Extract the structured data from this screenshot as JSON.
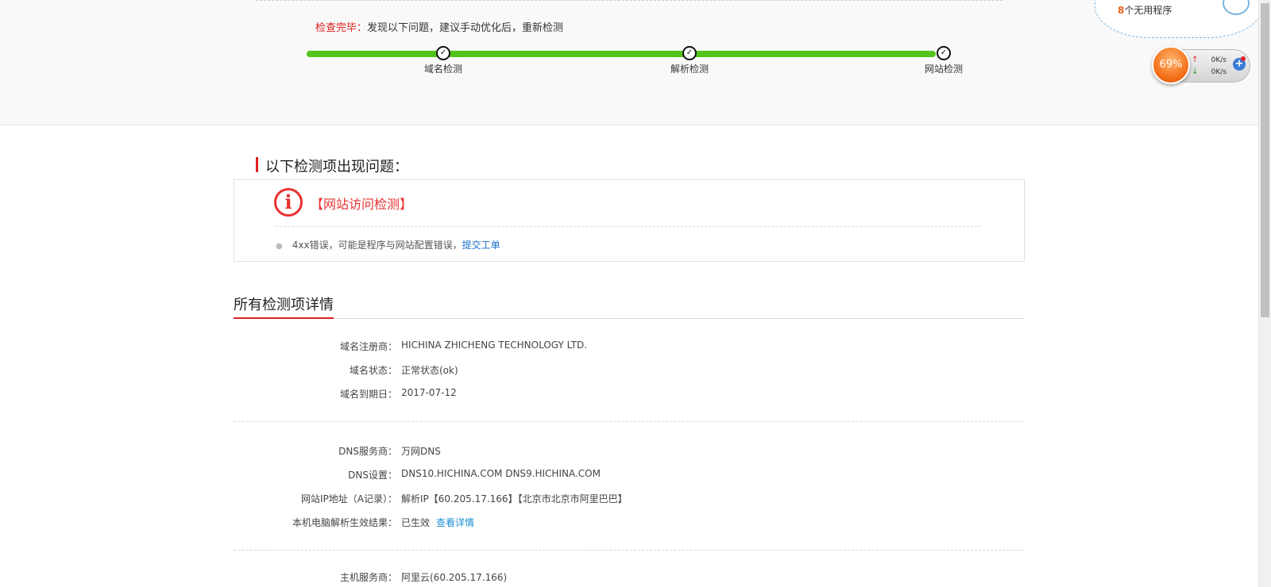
{
  "status": {
    "done_label": "检查完毕：",
    "message": "发现以下问题，建议手动优化后，重新检测",
    "steps": [
      {
        "label": "域名检测",
        "state": "complete"
      },
      {
        "label": "解析检测",
        "state": "complete"
      },
      {
        "label": "网站检测",
        "state": "complete"
      }
    ],
    "progress_percent": 100
  },
  "popup": {
    "text_count": "8",
    "text_rest": "个无用程序"
  },
  "widget": {
    "percent": "69%",
    "upload": "0K/s",
    "download": "0K/s"
  },
  "issues": {
    "title": "以下检测项出现问题：",
    "item_title": "【网站访问检测】",
    "detail_text": "4xx错误，可能是程序与网站配置错误，",
    "detail_link": "提交工单"
  },
  "details": {
    "title": "所有检测项详情",
    "groups": [
      [
        {
          "key": "域名注册商：",
          "value": "HICHINA ZHICHENG TECHNOLOGY LTD."
        },
        {
          "key": "域名状态：",
          "value": "正常状态(ok)"
        },
        {
          "key": "域名到期日：",
          "value": "2017-07-12"
        }
      ],
      [
        {
          "key": "DNS服务商：",
          "value": "万网DNS"
        },
        {
          "key": "DNS设置：",
          "value": "DNS10.HICHINA.COM DNS9.HICHINA.COM"
        },
        {
          "key": "网站IP地址（A记录）：",
          "value": "解析IP【60.205.17.166】【北京市北京市阿里巴巴】"
        },
        {
          "key": "本机电脑解析生效结果：",
          "value": "已生效",
          "link": "查看详情"
        }
      ],
      [
        {
          "key": "主机服务商：",
          "value": "阿里云(60.205.17.166)"
        }
      ]
    ]
  }
}
